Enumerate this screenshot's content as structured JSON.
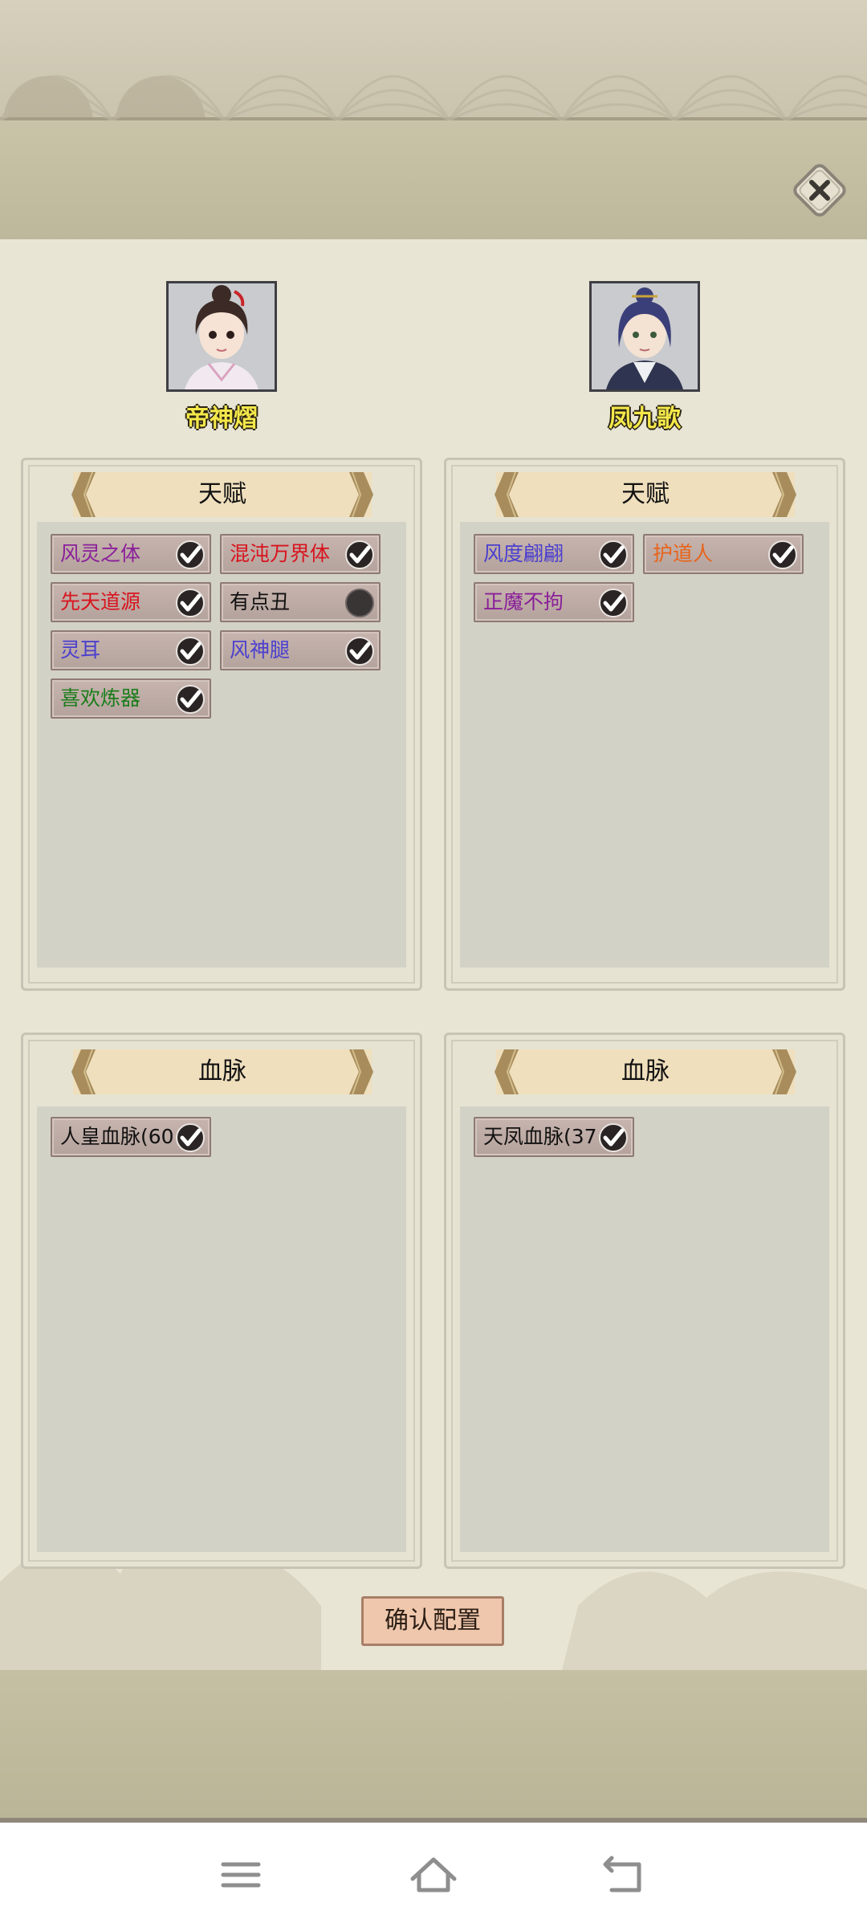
{
  "characters": [
    {
      "name": "帝神熠",
      "talent_title": "天赋",
      "talents": [
        {
          "label": "风灵之体",
          "color": "#8a1f9a",
          "checked": true
        },
        {
          "label": "混沌万界体",
          "color": "#d8141e",
          "checked": true
        },
        {
          "label": "先天道源",
          "color": "#d8141e",
          "checked": true
        },
        {
          "label": "有点丑",
          "color": "#111111",
          "checked": false
        },
        {
          "label": "灵耳",
          "color": "#4a3fcf",
          "checked": true
        },
        {
          "label": "风神腿",
          "color": "#4a3fcf",
          "checked": true
        },
        {
          "label": "喜欢炼器",
          "color": "#1b7d1b",
          "checked": true
        }
      ],
      "bloodline_title": "血脉",
      "bloodlines": [
        {
          "label": "人皇血脉(60",
          "color": "#111111",
          "checked": true
        }
      ]
    },
    {
      "name": "凤九歌",
      "talent_title": "天赋",
      "talents": [
        {
          "label": "风度翩翩",
          "color": "#4a3fcf",
          "checked": true
        },
        {
          "label": "护道人",
          "color": "#e8641a",
          "checked": true
        },
        {
          "label": "正魔不拘",
          "color": "#8a1f9a",
          "checked": true
        }
      ],
      "bloodline_title": "血脉",
      "bloodlines": [
        {
          "label": "天凤血脉(37",
          "color": "#111111",
          "checked": true
        }
      ]
    }
  ],
  "confirm_label": "确认配置",
  "icons": {
    "close": "close-icon",
    "check": "check-icon",
    "nav": [
      "menu-icon",
      "home-icon",
      "back-icon"
    ]
  }
}
